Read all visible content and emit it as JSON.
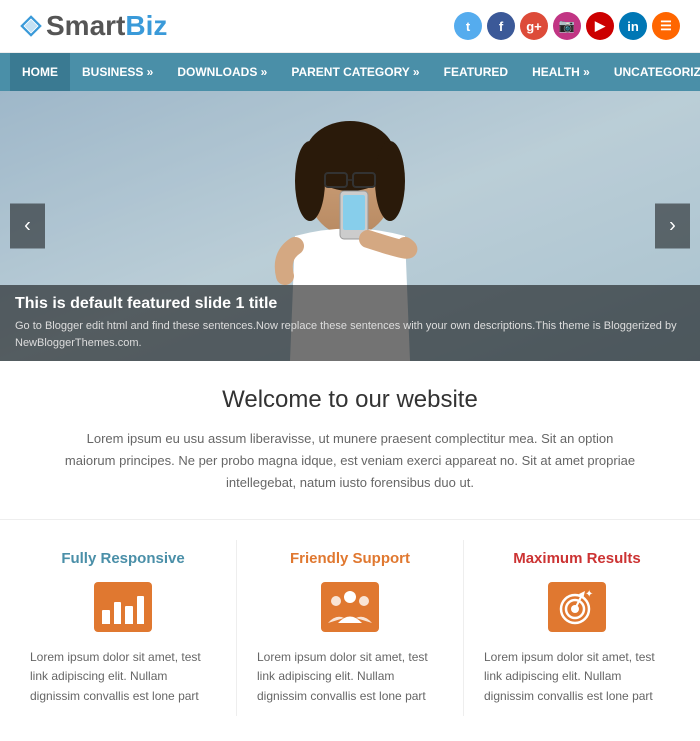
{
  "header": {
    "logo_smart": "Smart",
    "logo_biz": "Biz"
  },
  "nav": {
    "items": [
      {
        "label": "HOME",
        "active": true
      },
      {
        "label": "BUSINESS »",
        "active": false
      },
      {
        "label": "DOWNLOADS »",
        "active": false
      },
      {
        "label": "PARENT CATEGORY »",
        "active": false
      },
      {
        "label": "FEATURED",
        "active": false
      },
      {
        "label": "HEALTH »",
        "active": false
      },
      {
        "label": "UNCATEGORIZED",
        "active": false
      }
    ]
  },
  "slider": {
    "prev_label": "‹",
    "next_label": "›",
    "title": "This is default featured slide 1 title",
    "description": "Go to Blogger edit html and find these sentences.Now replace these sentences with your own descriptions.This theme is Bloggerized by NewBloggerThemes.com."
  },
  "welcome": {
    "title": "Welcome to our website",
    "text": "Lorem ipsum eu usu assum liberavisse, ut munere praesent complectitur mea. Sit an option maiorum principes. Ne per probo magna idque, est veniam exerci appareat no. Sit at amet propriae intellegebat, natum iusto forensibus duo ut."
  },
  "features": [
    {
      "title": "Fully Responsive",
      "color_class": "ft-blue",
      "icon": "bar-chart-icon",
      "text": "Lorem ipsum dolor sit amet, test link adipiscing elit. Nullam dignissim convallis est lone part"
    },
    {
      "title": "Friendly Support",
      "color_class": "ft-orange",
      "icon": "people-icon",
      "text": "Lorem ipsum dolor sit amet, test link adipiscing elit. Nullam dignissim convallis est lone part"
    },
    {
      "title": "Maximum Results",
      "color_class": "ft-red",
      "icon": "target-icon",
      "text": "Lorem ipsum dolor sit amet, test link adipiscing elit. Nullam dignissim convallis est lone part"
    }
  ]
}
